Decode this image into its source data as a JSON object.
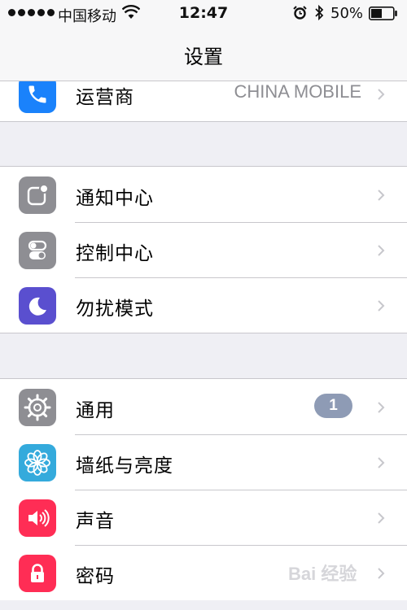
{
  "status_bar": {
    "carrier": "中国移动",
    "time": "12:47",
    "battery_percent": "50%",
    "battery_level": 0.5
  },
  "nav": {
    "title": "设置"
  },
  "groups": [
    {
      "rows": [
        {
          "label": "运营商",
          "value": "CHINA MOBILE",
          "icon": "phone-icon",
          "icon_color": "#1a82fb"
        }
      ]
    },
    {
      "rows": [
        {
          "label": "通知中心",
          "icon": "notification-center-icon",
          "icon_color": "#8e8e93"
        },
        {
          "label": "控制中心",
          "icon": "control-center-icon",
          "icon_color": "#8e8e93"
        },
        {
          "label": "勿扰模式",
          "icon": "moon-icon",
          "icon_color": "#5a4fcf"
        }
      ]
    },
    {
      "rows": [
        {
          "label": "通用",
          "badge": "1",
          "icon": "gear-icon",
          "icon_color": "#8e8e93"
        },
        {
          "label": "墙纸与亮度",
          "icon": "flower-icon",
          "icon_color": "#34aadc"
        },
        {
          "label": "声音",
          "icon": "speaker-icon",
          "icon_color": "#ff2d55"
        },
        {
          "label": "密码",
          "icon": "lock-icon",
          "icon_color": "#ff2d55"
        }
      ]
    }
  ],
  "watermark": "Bai 经验"
}
